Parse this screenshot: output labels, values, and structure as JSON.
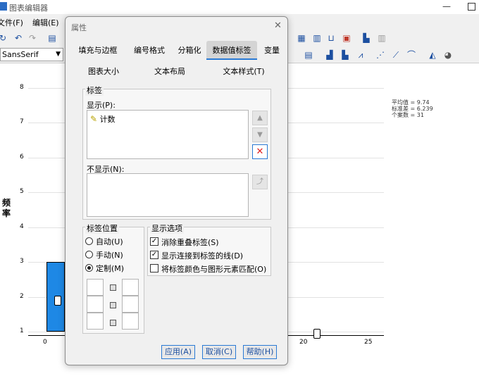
{
  "app": {
    "title": "图表编辑器"
  },
  "menu": {
    "items": [
      "文件(F)",
      "编辑(E)"
    ]
  },
  "toolbar": {
    "font_value": "SansSerif"
  },
  "chart_data": {
    "type": "bar",
    "ylabel": "频率",
    "yticks": [
      "1",
      "2",
      "3",
      "4",
      "5",
      "6",
      "7",
      "8"
    ],
    "xticks": [
      "0",
      "20",
      "25"
    ],
    "ylim": [
      1,
      8
    ],
    "bars": [
      {
        "x_start": 0,
        "x_end": 1.5,
        "value": 3
      }
    ],
    "stats": [
      "平均值 = 9.74",
      "标准差 = 6.239",
      "个案数 = 31"
    ],
    "bar_color": "#1e88e5"
  },
  "dialog": {
    "title": "属性",
    "tabs_row1": [
      "填充与边框",
      "编号格式",
      "分箱化",
      "数据值标签",
      "变量"
    ],
    "tabs_row2": [
      "图表大小",
      "文本布局",
      "文本样式(T)"
    ],
    "active_tab": "数据值标签",
    "labels_group": {
      "legend": "标签",
      "display_label": "显示(P):",
      "display_items": [
        "计数"
      ],
      "hidden_label": "不显示(N):"
    },
    "position_group": {
      "legend": "标签位置",
      "options": [
        "自动(U)",
        "手动(N)",
        "定制(M)"
      ],
      "selected": "定制(M)"
    },
    "options_group": {
      "legend": "显示选项",
      "items": [
        {
          "label": "消除重叠标签(S)",
          "checked": true
        },
        {
          "label": "显示连接到标签的线(D)",
          "checked": true
        },
        {
          "label": "将标签颜色与图形元素匹配(O)",
          "checked": false
        }
      ]
    },
    "buttons": {
      "apply": "应用(A)",
      "cancel": "取消(C)",
      "help": "帮助(H)"
    }
  }
}
